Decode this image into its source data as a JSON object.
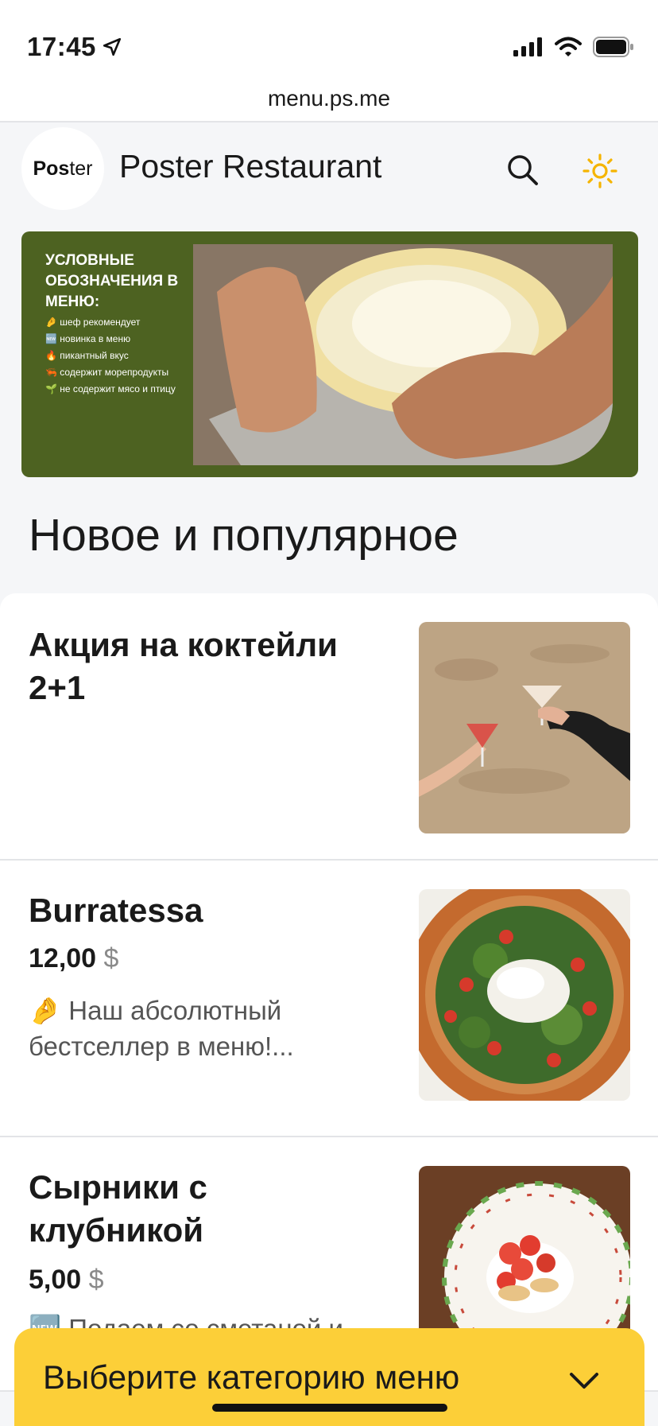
{
  "status_bar": {
    "time": "17:45",
    "icons": [
      "location-arrow-icon",
      "cellular-signal-icon",
      "wifi-icon",
      "battery-icon"
    ]
  },
  "browser": {
    "url": "menu.ps.me"
  },
  "header": {
    "logo_bold": "Pos",
    "logo_light": "ter",
    "restaurant_name": "Poster Restaurant",
    "search_icon": "search-icon",
    "theme_icon": "sun-icon"
  },
  "banner": {
    "title": "Условные обозначения в меню:",
    "legend": [
      {
        "emoji": "🤌",
        "text": "шеф рекомендует"
      },
      {
        "emoji": "🆕",
        "text": "новинка в меню"
      },
      {
        "emoji": "🔥",
        "text": "пикантный вкус"
      },
      {
        "emoji": "🦐",
        "text": "содержит морепродукты"
      },
      {
        "emoji": "🌱",
        "text": "не содержит мясо и птицу"
      }
    ]
  },
  "section_title": "Новое и популярное",
  "items": [
    {
      "title": "Акция на коктейли 2+1",
      "price": "",
      "currency": "",
      "description": ""
    },
    {
      "title": "Burratessa",
      "price": "12,00",
      "currency": "$",
      "description": "🤌 Наш абсолютный бестселлер в меню!..."
    },
    {
      "title": "Сырники с клубникой",
      "price": "5,00",
      "currency": "$",
      "description": "🆕 Подаем со сметаной и"
    }
  ],
  "category_bar": {
    "label": "Выберите категорию меню",
    "icon": "chevron-down-icon"
  },
  "colors": {
    "banner_green": "#4d6221",
    "category_yellow": "#fccf38",
    "sun_orange": "#f5b400"
  }
}
